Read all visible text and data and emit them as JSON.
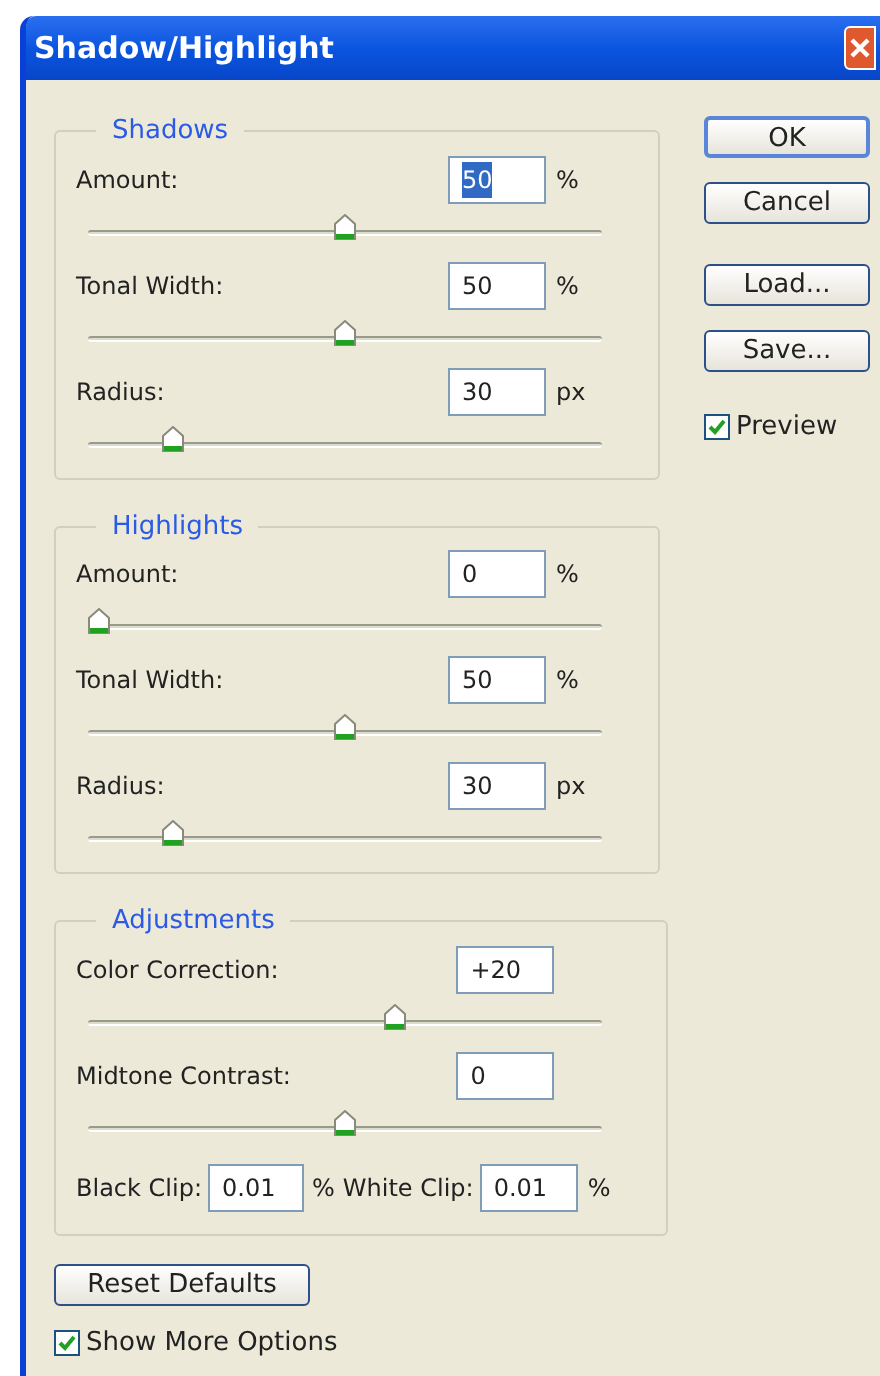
{
  "window": {
    "title": "Shadow/Highlight"
  },
  "groups": [
    {
      "title": "Shadows",
      "rows": [
        {
          "kind": "slider",
          "label": "Amount:",
          "value": "50",
          "unit": "%",
          "text_selected": true,
          "level": 0.5
        },
        {
          "kind": "slider",
          "label": "Tonal Width:",
          "value": "50",
          "unit": "%",
          "text_selected": false,
          "level": 0.5
        },
        {
          "kind": "slider",
          "label": "Radius:",
          "value": "30",
          "unit": "px",
          "text_selected": false,
          "level": 0.15
        }
      ]
    },
    {
      "title": "Highlights",
      "rows": [
        {
          "kind": "slider",
          "label": "Amount:",
          "value": "0",
          "unit": "%",
          "text_selected": false,
          "level": 0
        },
        {
          "kind": "slider",
          "label": "Tonal Width:",
          "value": "50",
          "unit": "%",
          "text_selected": false,
          "level": 0.5
        },
        {
          "kind": "slider",
          "label": "Radius:",
          "value": "30",
          "unit": "px",
          "text_selected": false,
          "level": 0.15
        }
      ]
    },
    {
      "title": "Adjustments",
      "rows": [
        {
          "kind": "slider",
          "label": "Color Correction:",
          "value": "+20",
          "text_selected": false,
          "level": 0.6
        },
        {
          "kind": "slider",
          "label": "Midtone Contrast:",
          "value": "0",
          "text_selected": false,
          "level": 0.5
        },
        {
          "kind": "clip",
          "label": "Black Clip:",
          "value": "0.01",
          "unit": "%",
          "label2": "White Clip:",
          "value2": "0.01",
          "unit2": "%"
        }
      ]
    }
  ],
  "buttons": [
    {
      "label": "OK",
      "default": true
    },
    {
      "label": "Cancel",
      "default": false
    },
    {
      "label": "Load...",
      "default": false
    },
    {
      "label": "Save...",
      "default": false
    }
  ],
  "preview": {
    "label": "Preview",
    "checked": true
  },
  "reset_button": {
    "label": "Reset Defaults"
  },
  "show_more": {
    "label": "Show More Options",
    "checked": true
  }
}
